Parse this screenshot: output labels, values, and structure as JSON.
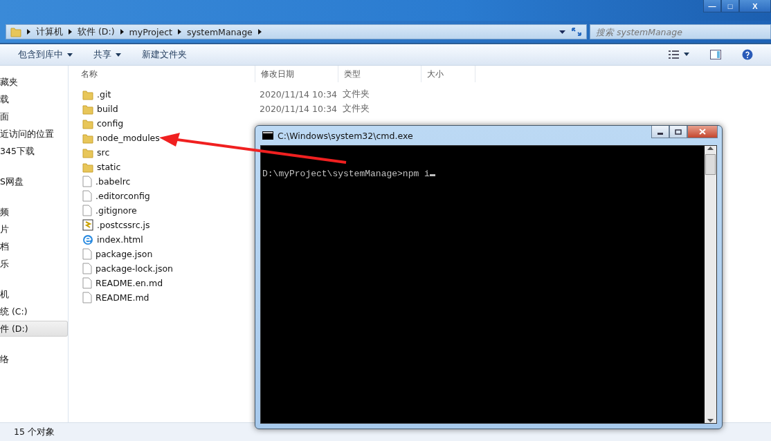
{
  "window": {
    "controls": [
      "—",
      "□",
      "X"
    ]
  },
  "address_bar": {
    "crumbs": [
      "计算机",
      "软件 (D:)",
      "myProject",
      "systemManage"
    ]
  },
  "search": {
    "placeholder": "搜索 systemManage"
  },
  "toolbar": {
    "buttons": [
      {
        "label": "包含到库中",
        "dropdown": true
      },
      {
        "label": "共享",
        "dropdown": true
      },
      {
        "label": "新建文件夹",
        "dropdown": false
      }
    ]
  },
  "sidebar": {
    "groups": [
      {
        "items": [
          {
            "label": "藏夹",
            "selected": false
          },
          {
            "label": "载",
            "selected": false
          },
          {
            "label": "面",
            "selected": false
          },
          {
            "label": "近访问的位置",
            "selected": false
          },
          {
            "label": "345下载",
            "selected": false
          }
        ]
      },
      {
        "items": [
          {
            "label": "S网盘",
            "selected": false
          }
        ]
      },
      {
        "items": [
          {
            "label": "频",
            "selected": false
          },
          {
            "label": "片",
            "selected": false
          },
          {
            "label": "档",
            "selected": false
          },
          {
            "label": "乐",
            "selected": false
          }
        ]
      },
      {
        "items": [
          {
            "label": "机",
            "selected": false
          },
          {
            "label": "统 (C:)",
            "selected": false
          },
          {
            "label": "件 (D:)",
            "selected": true
          }
        ]
      },
      {
        "items": [
          {
            "label": "络",
            "selected": false
          }
        ]
      }
    ]
  },
  "table": {
    "columns": [
      "名称",
      "修改日期",
      "类型",
      "大小"
    ],
    "rows": [
      {
        "kind": "folder",
        "name": ".git",
        "date": "2020/11/14 10:34",
        "type": "文件夹"
      },
      {
        "kind": "folder",
        "name": "build",
        "date": "2020/11/14 10:34",
        "type": "文件夹"
      },
      {
        "kind": "folder",
        "name": "config"
      },
      {
        "kind": "folder",
        "name": "node_modules"
      },
      {
        "kind": "folder",
        "name": "src"
      },
      {
        "kind": "folder",
        "name": "static"
      },
      {
        "kind": "file",
        "name": ".babelrc"
      },
      {
        "kind": "file",
        "name": ".editorconfig"
      },
      {
        "kind": "file",
        "name": ".gitignore"
      },
      {
        "kind": "script",
        "name": ".postcssrc.js"
      },
      {
        "kind": "web",
        "name": "index.html"
      },
      {
        "kind": "file",
        "name": "package.json"
      },
      {
        "kind": "file",
        "name": "package-lock.json"
      },
      {
        "kind": "file",
        "name": "README.en.md"
      },
      {
        "kind": "file",
        "name": "README.md"
      }
    ]
  },
  "status_bar": {
    "text": "15 个对象"
  },
  "console": {
    "title": "C:\\Windows\\system32\\cmd.exe",
    "prompt": "D:\\myProject\\systemManage>npm i"
  }
}
